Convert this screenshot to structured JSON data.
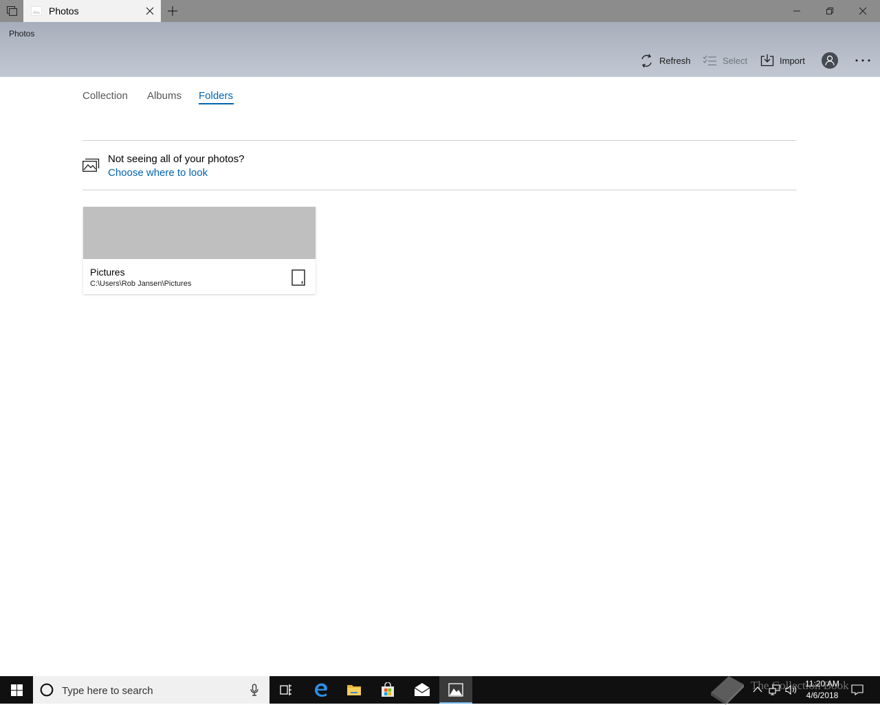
{
  "window": {
    "tab_title": "Photos",
    "app_name": "Photos"
  },
  "commands": {
    "refresh": "Refresh",
    "select": "Select",
    "import": "Import"
  },
  "nav": {
    "tabs": [
      {
        "label": "Collection",
        "active": false
      },
      {
        "label": "Albums",
        "active": false
      },
      {
        "label": "Folders",
        "active": true
      }
    ]
  },
  "banner": {
    "title": "Not seeing all of your photos?",
    "link": "Choose where to look"
  },
  "folders": [
    {
      "name": "Pictures",
      "path": "C:\\Users\\Rob Jansen\\Pictures"
    }
  ],
  "taskbar": {
    "search_placeholder": "Type here to search",
    "time": "11:20 AM",
    "date": "4/6/2018",
    "watermark": "The Collection Book"
  },
  "colors": {
    "accent": "#0063b1",
    "header": "#b6bdc9",
    "taskbar": "#101010",
    "thumbnail": "#bfbfbf"
  }
}
